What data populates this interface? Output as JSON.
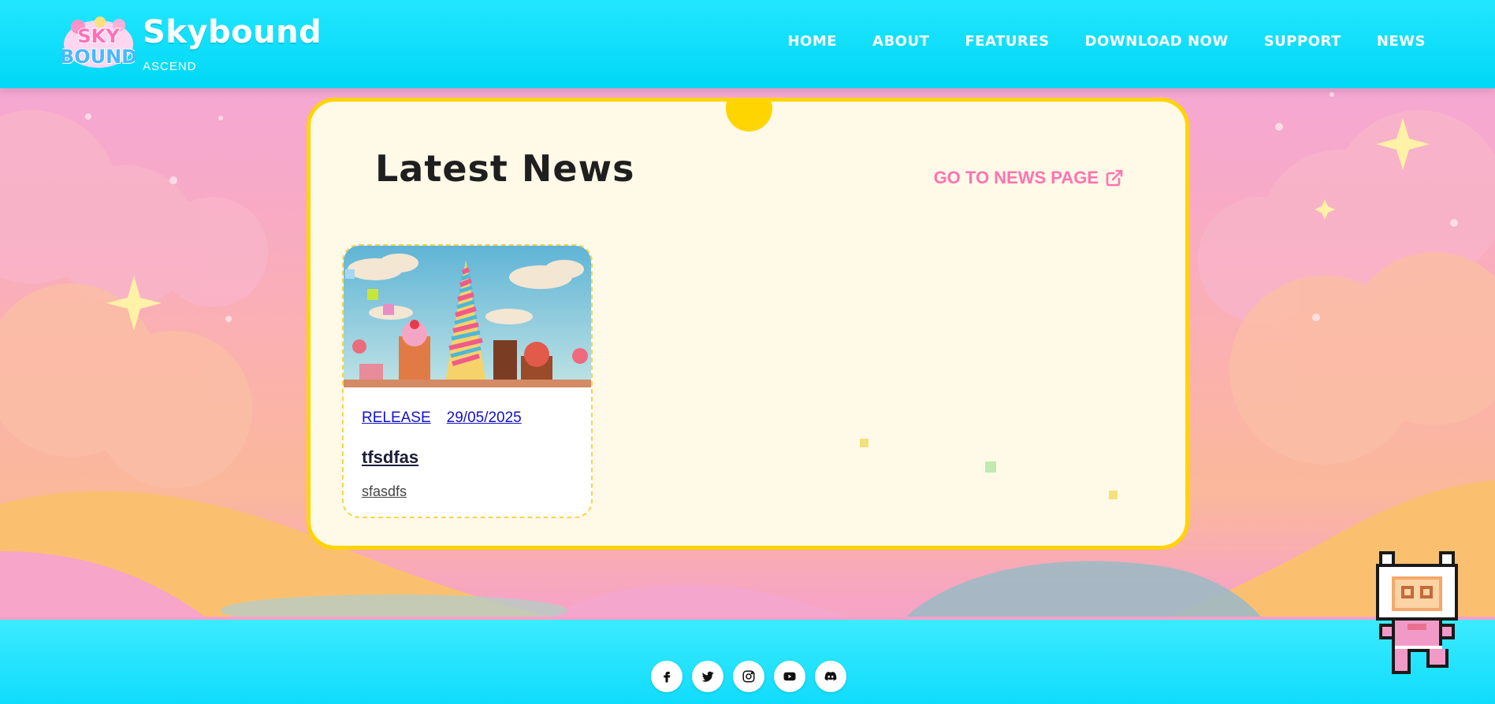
{
  "brand": {
    "logo_text": "SKY BOUND",
    "title": "Skybound",
    "subtitle": "ASCEND"
  },
  "nav": {
    "items": [
      {
        "label": "HOME"
      },
      {
        "label": "ABOUT"
      },
      {
        "label": "FEATURES"
      },
      {
        "label": "DOWNLOAD NOW"
      },
      {
        "label": "SUPPORT"
      },
      {
        "label": "NEWS"
      }
    ]
  },
  "news_section": {
    "heading": "Latest News",
    "link_label": "GO TO NEWS PAGE",
    "link_icon": "external-link-icon"
  },
  "news_items": [
    {
      "image_alt": "candy-land-skyline",
      "category": "RELEASE",
      "date": "29/05/2025",
      "title": "tfsdfas",
      "excerpt": "sfasdfs"
    }
  ],
  "footer": {
    "socials": [
      {
        "icon": "facebook-icon"
      },
      {
        "icon": "twitter-icon"
      },
      {
        "icon": "instagram-icon"
      },
      {
        "icon": "youtube-icon"
      },
      {
        "icon": "discord-icon"
      }
    ]
  },
  "colors": {
    "header_bg": "#00d8f6",
    "panel_bg": "#fff9e7",
    "panel_border": "#ffd400",
    "accent_pink": "#ff73b0",
    "link_blue": "#1212c8"
  }
}
